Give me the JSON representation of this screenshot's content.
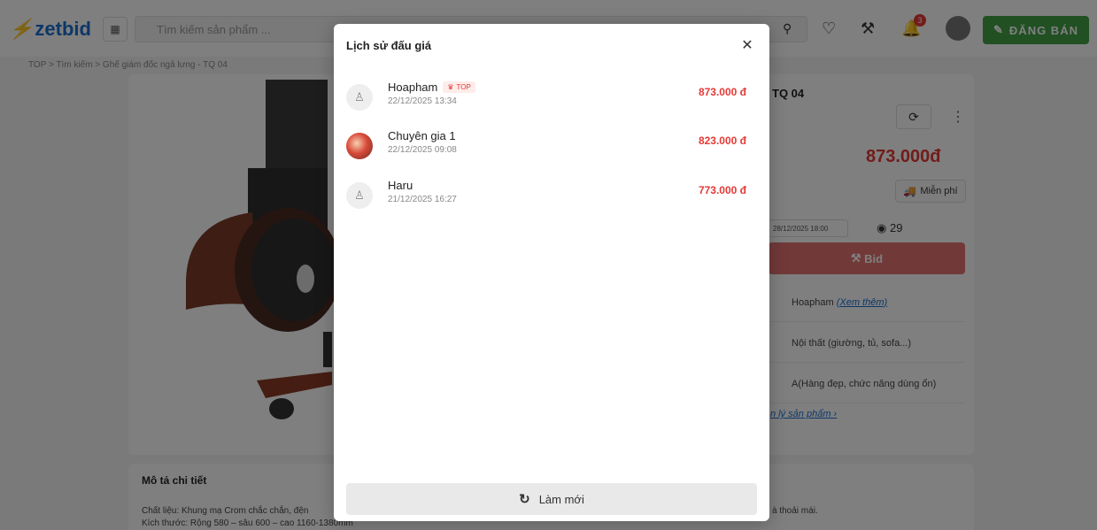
{
  "header": {
    "logo_text": "zetbid",
    "search_placeholder": "Tìm kiếm sản phẩm ...",
    "notification_count": "3",
    "sell_label": "ĐĂNG BÁN"
  },
  "breadcrumb": "TOP  >  Tìm kiếm  >  Ghế giám đốc ngả lưng - TQ 04",
  "product": {
    "title_fragment": "TQ 04",
    "price": "873.000đ",
    "shipping": "Miễn phí",
    "end_time": "28/12/2025 18:00",
    "views": "29",
    "bid_label": "Bid",
    "seller": "Hoapham",
    "seller_link": "(Xem thêm)",
    "category": "Nội thất (giường, tủ, sofa...)",
    "condition": "A(Hàng đẹp, chức năng dùng ổn)",
    "manage_link": "n lý sản phẩm"
  },
  "description": {
    "title": "Mô tả chi tiết",
    "line1": "Chất liệu: Khung mạ Crom chắc chắn, đện",
    "line2": "Kích thước: Rộng 580 – sâu 600 – cao 1160-1380mm",
    "line_right": "à thoải mái."
  },
  "modal": {
    "title": "Lịch sử đấu giá",
    "bids": [
      {
        "name": "Hoapham",
        "badge": "TOP",
        "time": "22/12/2025 13:34",
        "amount": "873.000 đ"
      },
      {
        "name": "Chuyên gia 1",
        "badge": "",
        "time": "22/12/2025 09:08",
        "amount": "823.000 đ"
      },
      {
        "name": "Haru",
        "badge": "",
        "time": "21/12/2025 16:27",
        "amount": "773.000 đ"
      }
    ],
    "refresh_label": "Làm mới"
  }
}
